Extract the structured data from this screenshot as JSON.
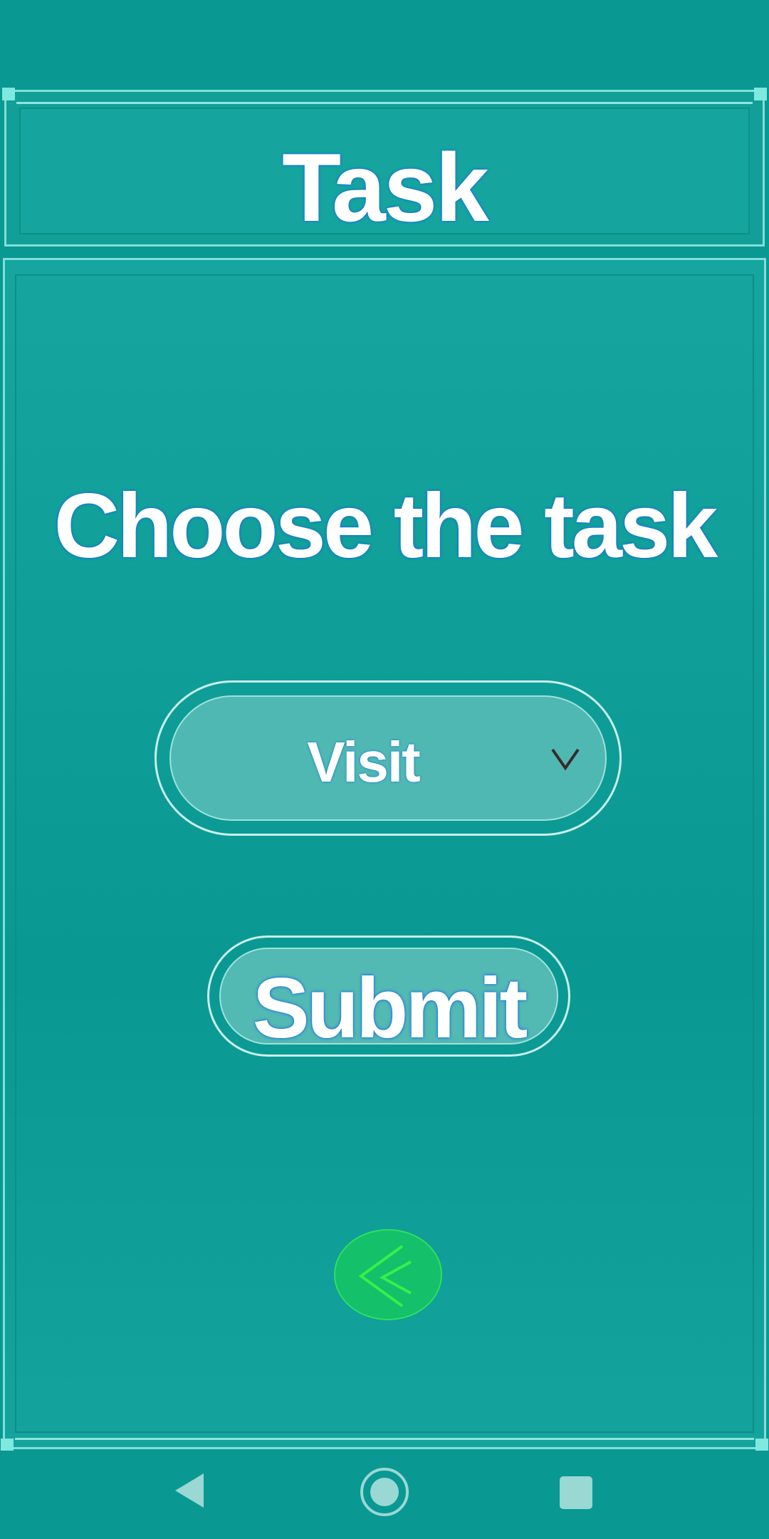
{
  "header": {
    "title": "Task"
  },
  "main": {
    "prompt": "Choose the task",
    "task_select": {
      "selected": "Visit",
      "icon": "chevron-down-icon"
    },
    "submit_label": "Submit",
    "back_icon": "double-chevron-left-icon"
  },
  "colors": {
    "background": "#0a9892",
    "frame_border": "#7fe0d8",
    "text": "#ffffff",
    "text_glow": "#1a6be0",
    "back_button": "#14c06a",
    "back_icon": "#2de05e"
  },
  "system_nav": {
    "back": "nav-back-icon",
    "home": "nav-home-icon",
    "recents": "nav-recents-icon"
  }
}
